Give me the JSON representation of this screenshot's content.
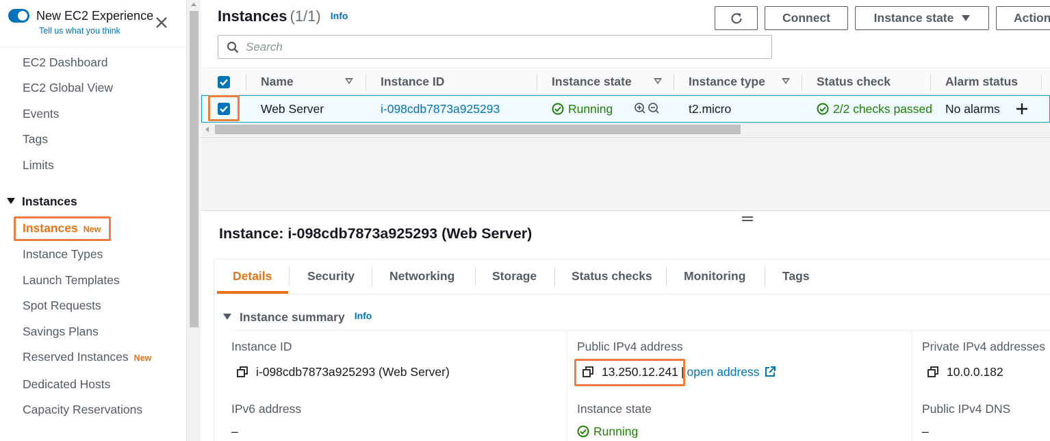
{
  "sidebar": {
    "experience_title": "New EC2 Experience",
    "experience_link": "Tell us what you think",
    "items_top": [
      "EC2 Dashboard",
      "EC2 Global View",
      "Events",
      "Tags",
      "Limits"
    ],
    "section_label": "Instances",
    "active_item": "Instances",
    "new_badge": "New",
    "items_section": [
      "Instance Types",
      "Launch Templates",
      "Spot Requests",
      "Savings Plans",
      "Reserved Instances",
      "Dedicated Hosts",
      "Capacity Reservations"
    ]
  },
  "header": {
    "title": "Instances",
    "count": "(1/1)",
    "info": "Info",
    "refresh_icon": "refresh-icon",
    "connect_label": "Connect",
    "instance_state_label": "Instance state",
    "actions_label": "Actions"
  },
  "search": {
    "placeholder": "Search"
  },
  "table": {
    "columns": [
      "Name",
      "Instance ID",
      "Instance state",
      "Instance type",
      "Status check",
      "Alarm status"
    ],
    "row": {
      "name": "Web Server",
      "instance_id": "i-098cdb7873a925293",
      "state": "Running",
      "type": "t2.micro",
      "status_check": "2/2 checks passed",
      "alarm_status": "No alarms"
    }
  },
  "detail": {
    "title": "Instance: i-098cdb7873a925293 (Web Server)",
    "tabs": [
      "Details",
      "Security",
      "Networking",
      "Storage",
      "Status checks",
      "Monitoring",
      "Tags"
    ],
    "active_tab": "Details",
    "summary_label": "Instance summary",
    "summary_info": "Info",
    "fields": {
      "instance_id_label": "Instance ID",
      "instance_id_value": "i-098cdb7873a925293 (Web Server)",
      "public_ipv4_label": "Public IPv4 address",
      "public_ipv4_value": "13.250.12.241",
      "open_address": "open address",
      "private_ipv4_label": "Private IPv4 addresses",
      "private_ipv4_value": "10.0.0.182",
      "ipv6_label": "IPv6 address",
      "ipv6_value": "–",
      "instance_state_label": "Instance state",
      "instance_state_value": "Running",
      "public_dns_label": "Public IPv4 DNS",
      "public_dns_value": "–"
    }
  },
  "colors": {
    "accent": "#0073bb",
    "highlight": "#ef7d3c",
    "success": "#1d8102",
    "active_tab": "#ec7211"
  }
}
